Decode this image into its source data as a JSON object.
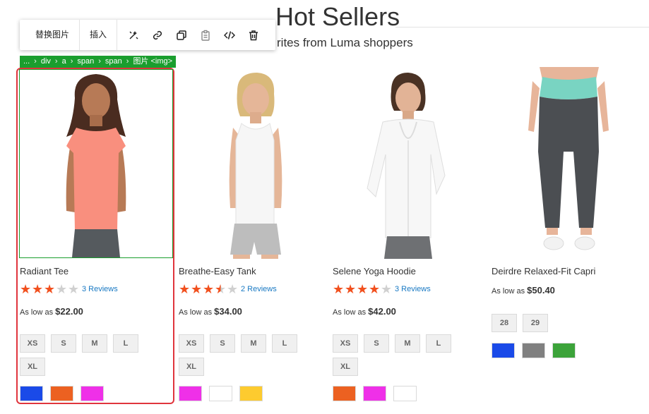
{
  "section": {
    "title": "Hot Sellers",
    "subtitle": "rites from Luma shoppers"
  },
  "toolbar": {
    "replace_image": "替换图片",
    "insert": "插入",
    "icons": [
      "magic-wand-icon",
      "link-icon",
      "copy-icon",
      "clipboard-icon",
      "code-icon",
      "trash-icon"
    ]
  },
  "breadcrumb": {
    "items": [
      "...",
      "div",
      "a",
      "span",
      "span",
      "图片 <img>"
    ]
  },
  "products": [
    {
      "name": "Radiant Tee",
      "rating_stars": 3,
      "reviews": "3  Reviews",
      "price_prefix": "As low as",
      "price": "$22.00",
      "sizes": [
        "XS",
        "S",
        "M",
        "L",
        "XL"
      ],
      "colors": [
        "#1a4ae8",
        "#ec6121",
        "#ef30e8"
      ]
    },
    {
      "name": "Breathe-Easy Tank",
      "rating_stars": 3.5,
      "reviews": "2  Reviews",
      "price_prefix": "As low as",
      "price": "$34.00",
      "sizes": [
        "XS",
        "S",
        "M",
        "L",
        "XL"
      ],
      "colors": [
        "#ef30e8",
        "#ffffff",
        "#fdcb2f"
      ]
    },
    {
      "name": "Selene Yoga Hoodie",
      "rating_stars": 4,
      "reviews": "3  Reviews",
      "price_prefix": "As low as",
      "price": "$42.00",
      "sizes": [
        "XS",
        "S",
        "M",
        "L",
        "XL"
      ],
      "colors": [
        "#ec6121",
        "#ef30e8",
        "#ffffff"
      ]
    },
    {
      "name": "Deirdre Relaxed-Fit Capri",
      "price_prefix": "As low as",
      "price": "$50.40",
      "sizes": [
        "28",
        "29"
      ],
      "colors": [
        "#1a4ae8",
        "#808080",
        "#3ca33a"
      ]
    }
  ],
  "colors": {
    "selection_red": "#e0353d",
    "selection_green": "#1a9e2e",
    "star_active": "#f1501e",
    "link": "#1979c3"
  }
}
